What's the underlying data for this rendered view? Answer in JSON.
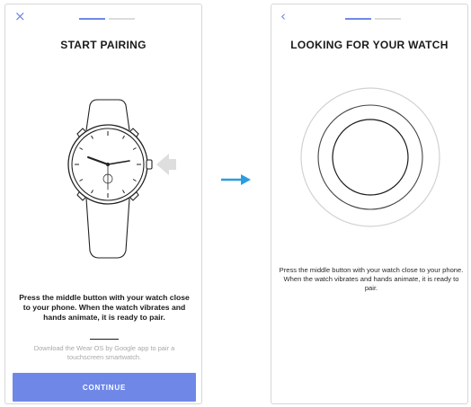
{
  "flow_arrow_color": "#2a9de0",
  "accent_color": "#6f88e8",
  "screen1": {
    "close_icon": "×",
    "progress": {
      "steps": 2,
      "current": 1
    },
    "title": "START PAIRING",
    "instruction": "Press the middle button with your watch close to your phone. When the watch vibrates and hands animate, it is ready to pair.",
    "hint": "Download the Wear OS by Google app to pair a touchscreen smartwatch.",
    "continue_label": "CONTINUE"
  },
  "screen2": {
    "back_icon": "‹",
    "progress": {
      "steps": 2,
      "current": 1
    },
    "title": "LOOKING FOR YOUR WATCH",
    "instruction": "Press the middle button with your watch close to your phone. When the watch vibrates and hands animate, it is ready to pair."
  }
}
